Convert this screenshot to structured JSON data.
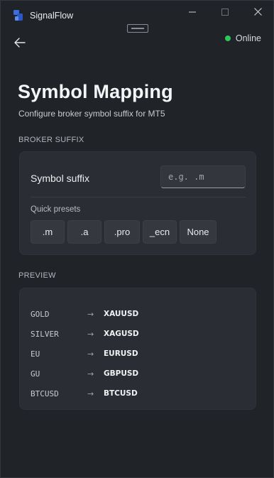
{
  "app": {
    "title": "SignalFlow"
  },
  "window_controls": {
    "minimize_icon": "minimize-icon",
    "maximize_icon": "maximize-icon",
    "close_icon": "close-icon"
  },
  "header": {
    "back_icon": "back-arrow-icon",
    "status_text": "Online",
    "status_color": "#2fc75a"
  },
  "page": {
    "title": "Symbol Mapping",
    "subtitle": "Configure broker symbol suffix for MT5"
  },
  "broker_suffix": {
    "section_label": "BROKER SUFFIX",
    "field_label": "Symbol suffix",
    "input_value": "",
    "input_placeholder": "e.g. .m",
    "presets_label": "Quick presets",
    "presets": [
      ".m",
      ".a",
      ".pro",
      "_ecn",
      "None"
    ]
  },
  "preview": {
    "section_label": "PREVIEW",
    "rows": [
      {
        "from": "GOLD",
        "arrow": "→",
        "to": "XAUUSD"
      },
      {
        "from": "SILVER",
        "arrow": "→",
        "to": "XAGUSD"
      },
      {
        "from": "EU",
        "arrow": "→",
        "to": "EURUSD"
      },
      {
        "from": "GU",
        "arrow": "→",
        "to": "GBPUSD"
      },
      {
        "from": "BTCUSD",
        "arrow": "→",
        "to": "BTCUSD"
      }
    ]
  },
  "colors": {
    "background": "#202328",
    "card": "#2a2d33",
    "accent_online": "#2fc75a",
    "app_icon": "#3b6fe0"
  }
}
